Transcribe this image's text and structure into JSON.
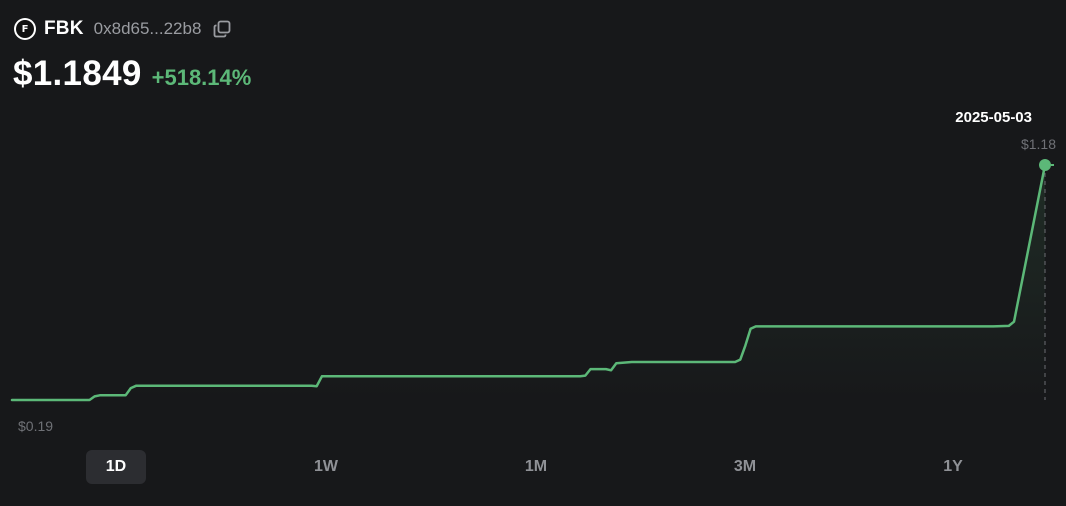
{
  "token": {
    "logo_letter": "F",
    "symbol": "FBK",
    "address": "0x8d65...22b8"
  },
  "price": {
    "value": "$1.1849",
    "change": "+518.14%"
  },
  "tooltip": {
    "date": "2025-05-03",
    "price": "$1.18"
  },
  "tabs": [
    {
      "label": "1D",
      "active": true
    },
    {
      "label": "1W",
      "active": false
    },
    {
      "label": "1M",
      "active": false
    },
    {
      "label": "3M",
      "active": false
    },
    {
      "label": "1Y",
      "active": false
    }
  ],
  "colors": {
    "background": "#17181a",
    "line": "#5cb878",
    "positive": "#5cb878",
    "muted": "#8f9196"
  },
  "chart_data": {
    "type": "line",
    "min_label": "$0.19",
    "max_label": "$1.18",
    "ylim": [
      0.19,
      1.18
    ],
    "x": [
      0,
      0.075,
      0.08,
      0.085,
      0.11,
      0.115,
      0.12,
      0.29,
      0.295,
      0.3,
      0.32,
      0.55,
      0.555,
      0.56,
      0.575,
      0.58,
      0.585,
      0.6,
      0.7,
      0.705,
      0.71,
      0.715,
      0.72,
      0.73,
      0.75,
      0.85,
      0.9,
      0.95,
      0.965,
      0.97,
      1.0
    ],
    "y": [
      0.19,
      0.19,
      0.205,
      0.21,
      0.21,
      0.24,
      0.25,
      0.25,
      0.248,
      0.29,
      0.29,
      0.29,
      0.293,
      0.32,
      0.32,
      0.315,
      0.345,
      0.35,
      0.35,
      0.36,
      0.42,
      0.49,
      0.5,
      0.5,
      0.5,
      0.5,
      0.5,
      0.5,
      0.502,
      0.52,
      1.18
    ],
    "grid": false,
    "legend": "none"
  }
}
